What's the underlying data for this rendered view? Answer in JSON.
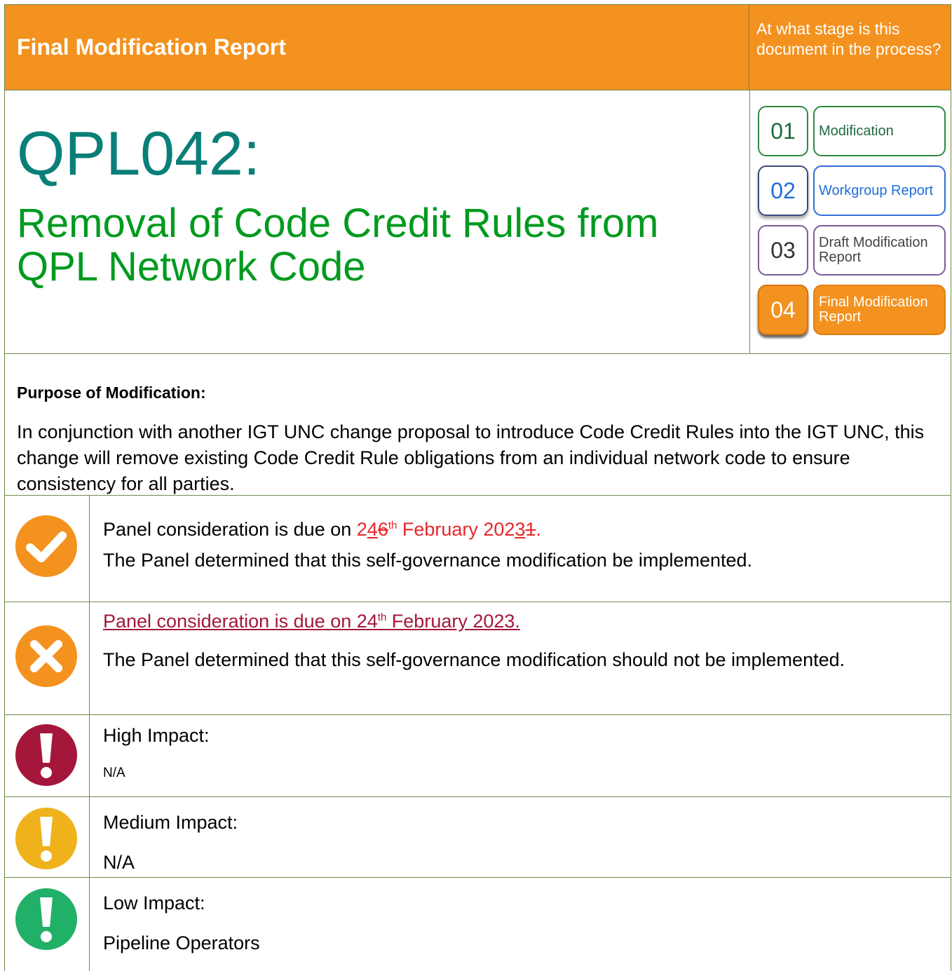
{
  "header": {
    "report_type": "Final Modification Report",
    "stage_question": "At what stage is this document in the process?"
  },
  "modification": {
    "code": "QPL042:",
    "title": "Removal of Code Credit Rules from QPL Network Code"
  },
  "stages": [
    {
      "num": "01",
      "label": "Modification"
    },
    {
      "num": "02",
      "label": "Workgroup Report"
    },
    {
      "num": "03",
      "label": "Draft Modification Report"
    },
    {
      "num": "04",
      "label": "Final Modification Report"
    }
  ],
  "purpose": {
    "heading": "Purpose of Modification:",
    "text": "In conjunction with another IGT UNC change proposal to introduce Code Credit Rules into the IGT UNC, this change will remove existing Code Credit Rule obligations from an individual network code to ensure consistency for all parties."
  },
  "decision_implement": {
    "line1_prefix": "Panel consideration is due on ",
    "date_2": "2",
    "date_4": "4",
    "date_6": "6",
    "date_th": "th",
    "date_month": " February 202",
    "date_3": "3",
    "date_1": "1",
    "date_end": ".",
    "line2": "The Panel determined that this self-governance modification be implemented."
  },
  "decision_reject": {
    "line1_prefix": "Panel consideration is due on 24",
    "line1_th": "th",
    "line1_suffix": " February 2023.",
    "line2": "The Panel determined that this self-governance modification should not be implemented."
  },
  "impacts": {
    "high": {
      "label": "High Impact:",
      "value": "N/A"
    },
    "medium": {
      "label": "Medium Impact:",
      "value": "N/A"
    },
    "low": {
      "label": "Low Impact:",
      "value": "Pipeline Operators"
    }
  },
  "colors": {
    "orange": "#f4921f",
    "teal": "#0a7f78",
    "green": "#009a1f",
    "high_impact": "#a4173a",
    "medium_impact": "#efb21b",
    "low_impact": "#21b067"
  }
}
